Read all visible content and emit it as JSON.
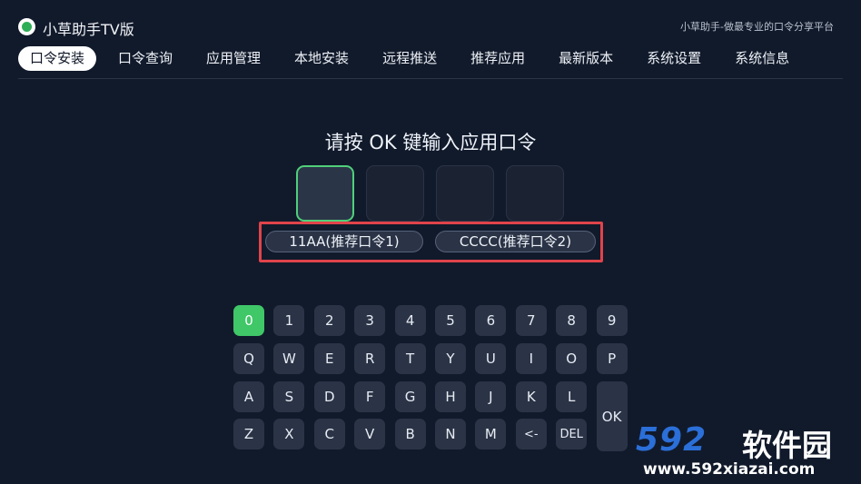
{
  "header": {
    "app_title": "小草助手TV版",
    "slogan": "小草助手-做最专业的口令分享平台"
  },
  "tabs": [
    {
      "label": "口令安装",
      "active": true
    },
    {
      "label": "口令查询"
    },
    {
      "label": "应用管理"
    },
    {
      "label": "本地安装"
    },
    {
      "label": "远程推送"
    },
    {
      "label": "推荐应用"
    },
    {
      "label": "最新版本"
    },
    {
      "label": "系统设置"
    },
    {
      "label": "系统信息"
    }
  ],
  "prompt": "请按 OK 键输入应用口令",
  "suggestions": [
    "11AA(推荐口令1)",
    "CCCC(推荐口令2)"
  ],
  "keyboard": {
    "row1": [
      "0",
      "1",
      "2",
      "3",
      "4",
      "5",
      "6",
      "7",
      "8",
      "9"
    ],
    "row2": [
      "Q",
      "W",
      "E",
      "R",
      "T",
      "Y",
      "U",
      "I",
      "O",
      "P"
    ],
    "row3": [
      "A",
      "S",
      "D",
      "F",
      "G",
      "H",
      "J",
      "K",
      "L"
    ],
    "row4": [
      "Z",
      "X",
      "C",
      "V",
      "B",
      "N",
      "M",
      "<-",
      "DEL"
    ],
    "ok": "OK",
    "selected": "0"
  },
  "watermark": {
    "number": "592",
    "name": "软件园",
    "url": "www.592xiazai.com"
  },
  "colors": {
    "background": "#111a2b",
    "accent_green": "#3fc768",
    "highlight_red": "#e0434b",
    "key_bg": "#2b3446"
  }
}
